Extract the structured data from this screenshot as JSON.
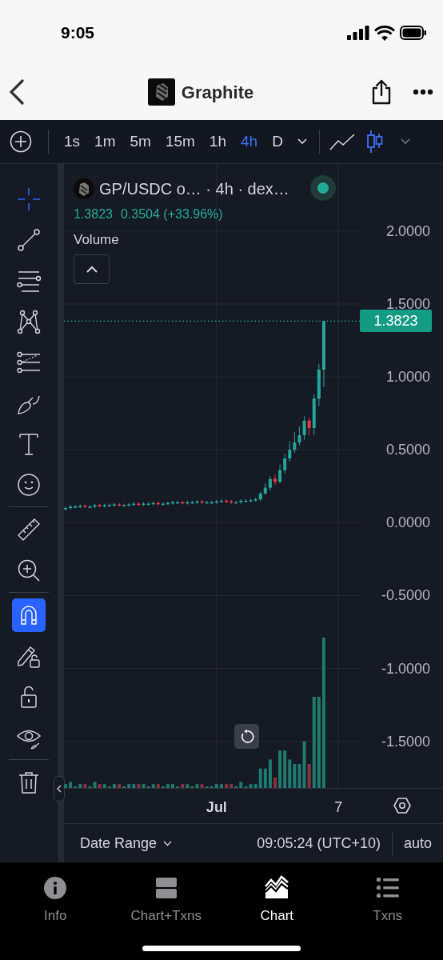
{
  "status_bar": {
    "time": "9:05"
  },
  "nav": {
    "title": "Graphite"
  },
  "toolbar": {
    "intervals": [
      {
        "label": "1s",
        "selected": false
      },
      {
        "label": "1m",
        "selected": false
      },
      {
        "label": "5m",
        "selected": false
      },
      {
        "label": "15m",
        "selected": false
      },
      {
        "label": "1h",
        "selected": false
      },
      {
        "label": "4h",
        "selected": true
      },
      {
        "label": "D",
        "selected": false
      }
    ],
    "chart_types": [
      {
        "kind": "line",
        "selected": false
      },
      {
        "kind": "candles",
        "selected": true
      }
    ]
  },
  "tools": [
    {
      "kind": "crosshair",
      "active": true
    },
    {
      "kind": "trend-line",
      "active": false
    },
    {
      "kind": "parallel-lines",
      "active": false
    },
    {
      "kind": "pattern",
      "active": false
    },
    {
      "kind": "fib",
      "active": false
    },
    {
      "kind": "brush",
      "active": false
    },
    {
      "kind": "text",
      "active": false
    },
    {
      "kind": "emoji",
      "active": false
    },
    {
      "kind": "divider"
    },
    {
      "kind": "ruler",
      "active": false
    },
    {
      "kind": "zoom",
      "active": false
    },
    {
      "kind": "divider"
    },
    {
      "kind": "magnet",
      "active": true
    },
    {
      "kind": "pencil-lock",
      "active": false
    },
    {
      "kind": "lock",
      "active": false
    },
    {
      "kind": "eye",
      "active": false
    },
    {
      "kind": "divider"
    },
    {
      "kind": "trash",
      "active": false
    }
  ],
  "legend": {
    "symbol": "GP/USDC o… · 4h · dex…",
    "live": true,
    "last": "1.3823",
    "change": "0.3504 (+33.96%)",
    "volume_label": "Volume"
  },
  "last_price": "1.3823",
  "chart_data": {
    "type": "candlestick",
    "categories": [
      null,
      null,
      null,
      null,
      null,
      null,
      null,
      null,
      null,
      null,
      null,
      null,
      null,
      null,
      null,
      null,
      null,
      null,
      null,
      null,
      null,
      null,
      null,
      null,
      null,
      null,
      null,
      null,
      null,
      null,
      null,
      "Jul",
      null,
      null,
      null,
      null,
      null,
      null,
      null,
      null,
      null,
      null,
      null,
      null,
      null,
      null,
      null,
      null,
      null,
      null,
      null,
      null,
      null,
      null,
      null,
      null,
      "7"
    ],
    "ohlc": [
      [
        0.095,
        0.11,
        0.085,
        0.1
      ],
      [
        0.1,
        0.12,
        0.09,
        0.11
      ],
      [
        0.11,
        0.12,
        0.1,
        0.11
      ],
      [
        0.11,
        0.125,
        0.1,
        0.115
      ],
      [
        0.115,
        0.125,
        0.1,
        0.11
      ],
      [
        0.11,
        0.12,
        0.1,
        0.11
      ],
      [
        0.11,
        0.13,
        0.1,
        0.12
      ],
      [
        0.12,
        0.13,
        0.105,
        0.115
      ],
      [
        0.115,
        0.13,
        0.105,
        0.12
      ],
      [
        0.12,
        0.13,
        0.11,
        0.12
      ],
      [
        0.12,
        0.135,
        0.11,
        0.125
      ],
      [
        0.125,
        0.135,
        0.11,
        0.12
      ],
      [
        0.12,
        0.13,
        0.11,
        0.12
      ],
      [
        0.12,
        0.135,
        0.11,
        0.125
      ],
      [
        0.125,
        0.14,
        0.115,
        0.13
      ],
      [
        0.13,
        0.14,
        0.115,
        0.125
      ],
      [
        0.125,
        0.14,
        0.115,
        0.13
      ],
      [
        0.13,
        0.14,
        0.12,
        0.13
      ],
      [
        0.13,
        0.145,
        0.12,
        0.135
      ],
      [
        0.135,
        0.145,
        0.12,
        0.13
      ],
      [
        0.13,
        0.14,
        0.12,
        0.13
      ],
      [
        0.13,
        0.145,
        0.12,
        0.135
      ],
      [
        0.135,
        0.15,
        0.125,
        0.14
      ],
      [
        0.14,
        0.15,
        0.13,
        0.14
      ],
      [
        0.14,
        0.15,
        0.125,
        0.135
      ],
      [
        0.135,
        0.15,
        0.125,
        0.14
      ],
      [
        0.14,
        0.15,
        0.13,
        0.14
      ],
      [
        0.14,
        0.155,
        0.13,
        0.145
      ],
      [
        0.145,
        0.155,
        0.13,
        0.14
      ],
      [
        0.14,
        0.15,
        0.13,
        0.14
      ],
      [
        0.14,
        0.15,
        0.13,
        0.14
      ],
      [
        0.14,
        0.155,
        0.13,
        0.145
      ],
      [
        0.145,
        0.16,
        0.135,
        0.15
      ],
      [
        0.15,
        0.16,
        0.135,
        0.145
      ],
      [
        0.145,
        0.155,
        0.13,
        0.14
      ],
      [
        0.14,
        0.15,
        0.13,
        0.14
      ],
      [
        0.14,
        0.16,
        0.13,
        0.15
      ],
      [
        0.15,
        0.16,
        0.14,
        0.15
      ],
      [
        0.15,
        0.165,
        0.14,
        0.155
      ],
      [
        0.155,
        0.17,
        0.145,
        0.16
      ],
      [
        0.16,
        0.21,
        0.15,
        0.2
      ],
      [
        0.2,
        0.27,
        0.19,
        0.24
      ],
      [
        0.24,
        0.32,
        0.22,
        0.3
      ],
      [
        0.3,
        0.33,
        0.26,
        0.28
      ],
      [
        0.28,
        0.4,
        0.27,
        0.36
      ],
      [
        0.36,
        0.47,
        0.34,
        0.44
      ],
      [
        0.44,
        0.56,
        0.42,
        0.5
      ],
      [
        0.5,
        0.62,
        0.48,
        0.55
      ],
      [
        0.55,
        0.66,
        0.53,
        0.6
      ],
      [
        0.6,
        0.73,
        0.57,
        0.7
      ],
      [
        0.7,
        0.72,
        0.6,
        0.65
      ],
      [
        0.65,
        0.88,
        0.6,
        0.85
      ],
      [
        0.85,
        1.09,
        0.8,
        1.05
      ],
      [
        1.05,
        1.3823,
        0.93,
        1.3823
      ],
      null,
      null,
      null
    ],
    "ylim": [
      -1.82,
      2.46
    ],
    "grid": true,
    "ref_lines": [
      {
        "axis": "y",
        "value": 1.3823
      }
    ],
    "yticks": [
      {
        "value": 2,
        "label": "2.0000"
      },
      {
        "value": 1.5,
        "label": "1.5000"
      },
      {
        "value": 1,
        "label": "1.0000"
      },
      {
        "value": 0.5,
        "label": "0.5000"
      },
      {
        "value": 0,
        "label": "0.0000"
      },
      {
        "value": -0.5,
        "label": "-0.5000"
      },
      {
        "value": -1,
        "label": "-1.0000"
      },
      {
        "value": -1.5,
        "label": "-1.5000"
      }
    ]
  },
  "bottom_bar": {
    "date_range": "Date Range",
    "time": "09:05:24 (UTC+10)",
    "scale": "auto"
  },
  "tab_bar": [
    {
      "kind": "info",
      "label": "Info",
      "selected": false
    },
    {
      "kind": "split",
      "label": "Chart+Txns",
      "selected": false
    },
    {
      "kind": "chart",
      "label": "Chart",
      "selected": true
    },
    {
      "kind": "list",
      "label": "Txns",
      "selected": false
    }
  ]
}
